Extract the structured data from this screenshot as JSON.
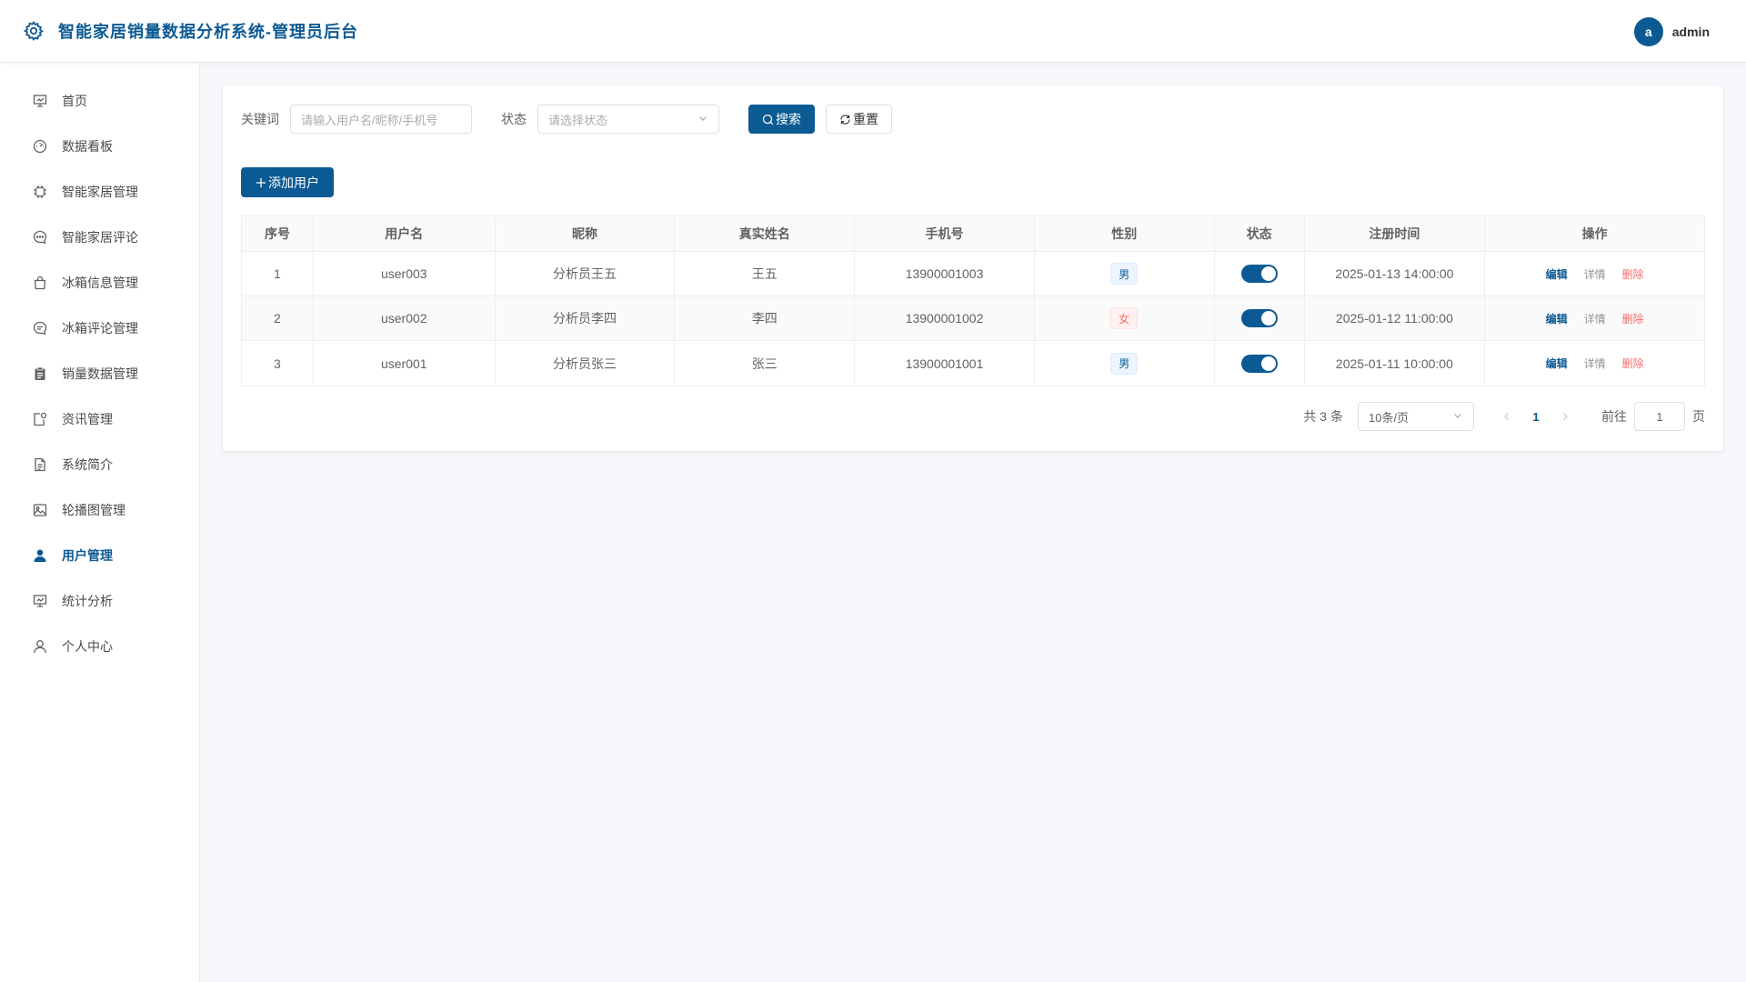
{
  "header": {
    "title": "智能家居销量数据分析系统-管理员后台",
    "avatar_letter": "a",
    "username": "admin"
  },
  "sidebar": {
    "items": [
      {
        "label": "首页",
        "icon": "presentation-icon"
      },
      {
        "label": "数据看板",
        "icon": "dashboard-icon"
      },
      {
        "label": "智能家居管理",
        "icon": "cpu-icon"
      },
      {
        "label": "智能家居评论",
        "icon": "chat-dots-icon"
      },
      {
        "label": "冰箱信息管理",
        "icon": "shopping-bag-icon"
      },
      {
        "label": "冰箱评论管理",
        "icon": "chat-line-icon"
      },
      {
        "label": "销量数据管理",
        "icon": "clipboard-icon"
      },
      {
        "label": "资讯管理",
        "icon": "notebook-icon"
      },
      {
        "label": "系统简介",
        "icon": "document-icon"
      },
      {
        "label": "轮播图管理",
        "icon": "picture-icon"
      },
      {
        "label": "用户管理",
        "icon": "user-filled-icon"
      },
      {
        "label": "统计分析",
        "icon": "presentation-chart-icon"
      },
      {
        "label": "个人中心",
        "icon": "user-icon"
      }
    ],
    "active_index": 10
  },
  "filters": {
    "keyword_label": "关键词",
    "keyword_placeholder": "请输入用户名/昵称/手机号",
    "status_label": "状态",
    "status_placeholder": "请选择状态",
    "search_label": "搜索",
    "reset_label": "重置"
  },
  "add_button": "添加用户",
  "table": {
    "columns": [
      "序号",
      "用户名",
      "昵称",
      "真实姓名",
      "手机号",
      "性别",
      "状态",
      "注册时间",
      "操作"
    ],
    "rows": [
      {
        "index": "1",
        "username": "user003",
        "nickname": "分析员王五",
        "realname": "王五",
        "phone": "13900001003",
        "gender": "男",
        "enabled": true,
        "registered": "2025-01-13 14:00:00"
      },
      {
        "index": "2",
        "username": "user002",
        "nickname": "分析员李四",
        "realname": "李四",
        "phone": "13900001002",
        "gender": "女",
        "enabled": true,
        "registered": "2025-01-12 11:00:00"
      },
      {
        "index": "3",
        "username": "user001",
        "nickname": "分析员张三",
        "realname": "张三",
        "phone": "13900001001",
        "gender": "男",
        "enabled": true,
        "registered": "2025-01-11 10:00:00"
      }
    ],
    "ops": {
      "edit": "编辑",
      "detail": "详情",
      "delete": "删除"
    }
  },
  "pagination": {
    "total_text": "共 3 条",
    "page_size": "10条/页",
    "current_page": "1",
    "goto_label": "前往",
    "goto_value": "1",
    "page_suffix": "页"
  },
  "colors": {
    "primary": "#0c5a93",
    "danger": "#f56c6c"
  }
}
